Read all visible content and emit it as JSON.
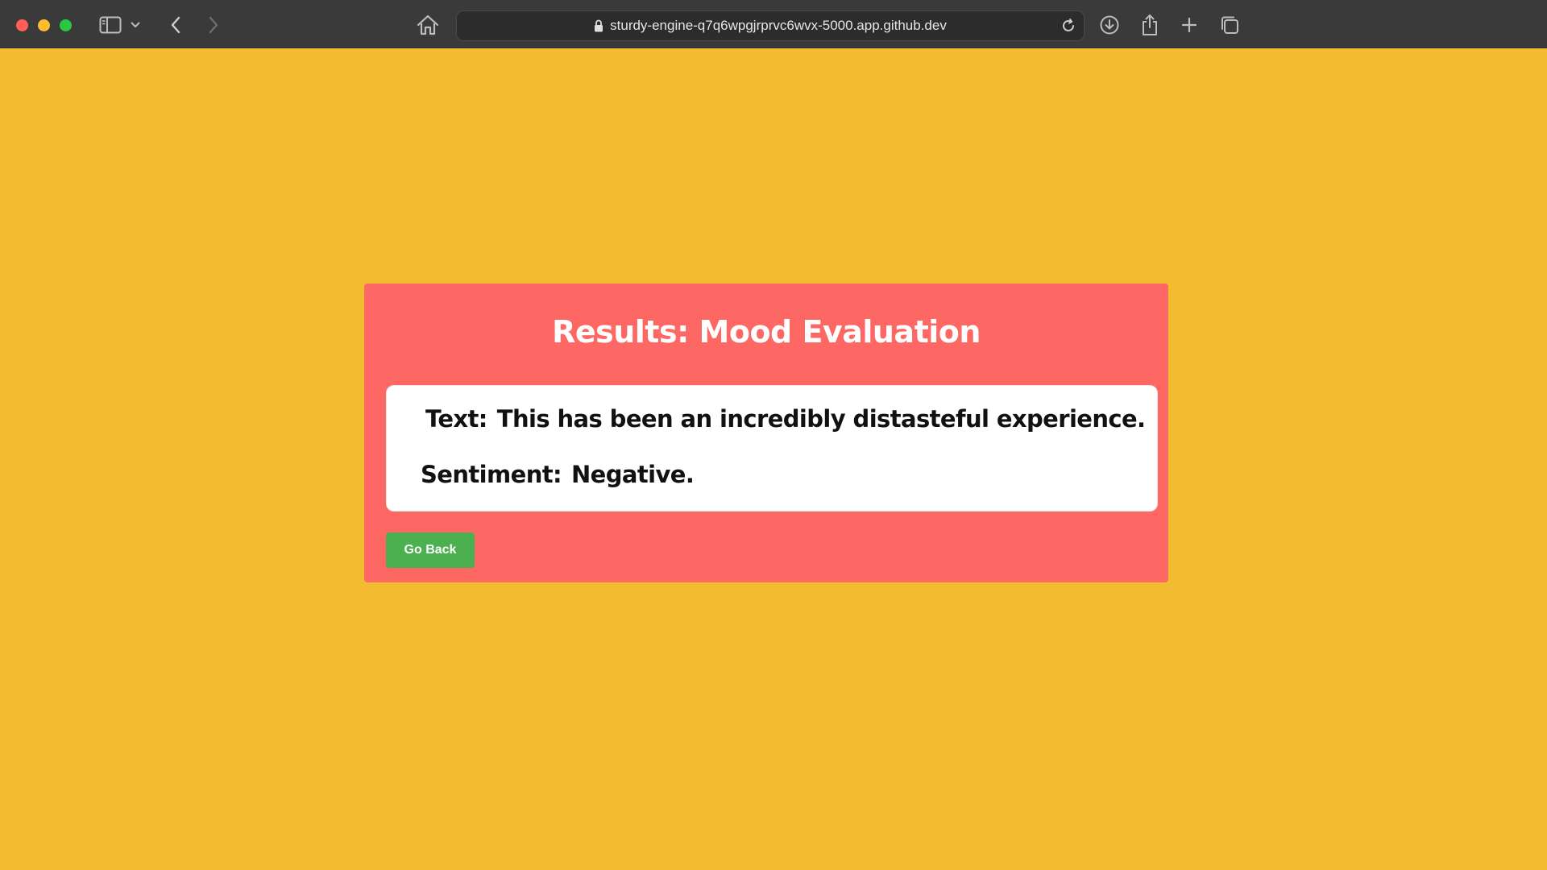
{
  "browser": {
    "url": "sturdy-engine-q7q6wpgjrprvc6wvx-5000.app.github.dev",
    "icons": [
      "close-button",
      "minimize-button",
      "maximize-button",
      "sidebar-icon",
      "chevron-down-icon",
      "back-icon",
      "forward-icon",
      "home-icon",
      "lock-icon",
      "reload-icon",
      "download-icon",
      "share-icon",
      "plus-icon",
      "tabs-icon"
    ]
  },
  "page": {
    "title": "Results: Mood Evaluation",
    "text_label": "Text:",
    "text_value": "This has been an incredibly distasteful experience.",
    "sentiment_label": "Sentiment:",
    "sentiment_value": "Negative.",
    "go_back_label": "Go Back"
  },
  "colors": {
    "page_background": "#f2bb30",
    "card_background": "#fe6864",
    "button_background": "#4caf50",
    "result_box_background": "#ffffff"
  }
}
